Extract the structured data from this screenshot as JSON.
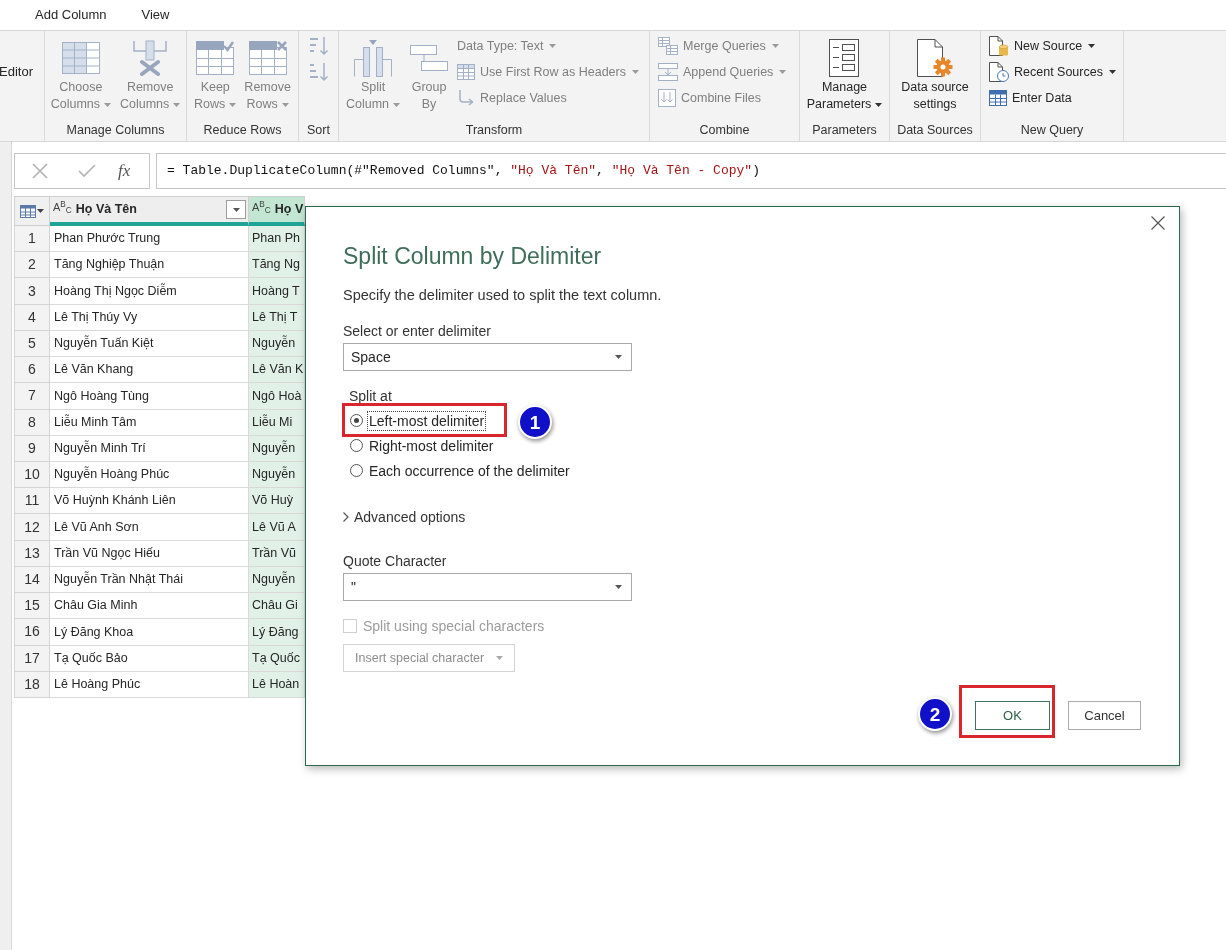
{
  "menu_tabs": [
    "Add Column",
    "View"
  ],
  "ribbon": {
    "stub_label": "Editor",
    "groups": [
      {
        "label": "Manage Columns",
        "buttons": [
          {
            "kind": "large",
            "lines": [
              "Choose",
              "Columns"
            ],
            "dropdown": true,
            "disabled": true
          },
          {
            "kind": "large",
            "lines": [
              "Remove",
              "Columns"
            ],
            "dropdown": true,
            "disabled": true
          }
        ]
      },
      {
        "label": "Reduce Rows",
        "buttons": [
          {
            "kind": "large",
            "lines": [
              "Keep",
              "Rows"
            ],
            "dropdown": true,
            "disabled": true
          },
          {
            "kind": "large",
            "lines": [
              "Remove",
              "Rows"
            ],
            "dropdown": true,
            "disabled": true
          }
        ]
      },
      {
        "label": "Sort",
        "buttons": [
          {
            "kind": "icon",
            "disabled": true
          },
          {
            "kind": "icon",
            "disabled": true
          }
        ]
      },
      {
        "label": "Transform",
        "buttons": [
          {
            "kind": "large",
            "lines": [
              "Split",
              "Column"
            ],
            "dropdown": true,
            "disabled": true
          },
          {
            "kind": "large",
            "lines": [
              "Group",
              "By"
            ],
            "dropdown": false,
            "disabled": true
          },
          {
            "kind": "small",
            "label": "Data Type: Text",
            "dropdown": true,
            "disabled": true
          },
          {
            "kind": "small",
            "label": "Use First Row as Headers",
            "dropdown": true,
            "disabled": true
          },
          {
            "kind": "small",
            "label": "Replace Values",
            "dropdown": false,
            "disabled": true
          }
        ]
      },
      {
        "label": "Combine",
        "buttons": [
          {
            "kind": "small",
            "label": "Merge Queries",
            "dropdown": true,
            "disabled": true
          },
          {
            "kind": "small",
            "label": "Append Queries",
            "dropdown": true,
            "disabled": true
          },
          {
            "kind": "small",
            "label": "Combine Files",
            "dropdown": false,
            "disabled": true
          }
        ]
      },
      {
        "label": "Parameters",
        "buttons": [
          {
            "kind": "large",
            "lines": [
              "Manage",
              "Parameters"
            ],
            "dropdown": true,
            "disabled": false
          }
        ]
      },
      {
        "label": "Data Sources",
        "buttons": [
          {
            "kind": "large",
            "lines": [
              "Data source",
              "settings"
            ],
            "dropdown": false,
            "disabled": false
          }
        ]
      },
      {
        "label": "New Query",
        "buttons": [
          {
            "kind": "small",
            "label": "New Source",
            "dropdown": true,
            "disabled": false
          },
          {
            "kind": "small",
            "label": "Recent Sources",
            "dropdown": true,
            "disabled": false
          },
          {
            "kind": "small",
            "label": "Enter Data",
            "dropdown": false,
            "disabled": false
          }
        ]
      }
    ]
  },
  "formula_bar": {
    "fx_label": "fx",
    "formula": [
      {
        "text": "= Table.DuplicateColumn(#\"Removed Columns\", ",
        "kind": "code"
      },
      {
        "text": "\"Họ Và Tên\"",
        "kind": "string"
      },
      {
        "text": ", ",
        "kind": "code"
      },
      {
        "text": "\"Họ Và Tên - Copy\"",
        "kind": "string"
      },
      {
        "text": ")",
        "kind": "code"
      }
    ]
  },
  "table": {
    "columns": [
      {
        "type": "A$^{B}$$_{C}$",
        "label": "Họ Và Tên",
        "selected": false,
        "filter": true
      },
      {
        "type": "A$^{B}$$_{C}$",
        "label": "Họ V",
        "selected": true
      }
    ],
    "rows": [
      {
        "number": "1",
        "cells": [
          "Phan Phước Trung",
          "Phan Ph"
        ]
      },
      {
        "number": "2",
        "cells": [
          "Tăng Nghiệp Thuận",
          "Tăng Ng"
        ]
      },
      {
        "number": "3",
        "cells": [
          "Hoàng Thị Ngọc Diễm",
          "Hoàng T"
        ]
      },
      {
        "number": "4",
        "cells": [
          "Lê Thị Thúy Vy",
          "Lê Thị T"
        ]
      },
      {
        "number": "5",
        "cells": [
          "Nguyễn Tuấn Kiệt",
          "Nguyễn"
        ]
      },
      {
        "number": "6",
        "cells": [
          "Lê Văn Khang",
          "Lê Văn K"
        ]
      },
      {
        "number": "7",
        "cells": [
          "Ngô Hoàng Tùng",
          "Ngô Hoà"
        ]
      },
      {
        "number": "8",
        "cells": [
          "Liễu Minh Tâm",
          "Liễu Mi"
        ]
      },
      {
        "number": "9",
        "cells": [
          "Nguyễn Minh Trí",
          "Nguyễn"
        ]
      },
      {
        "number": "10",
        "cells": [
          "Nguyễn Hoàng Phúc",
          "Nguyễn"
        ]
      },
      {
        "number": "11",
        "cells": [
          "Võ Huỳnh Khánh Liên",
          "Võ Huỳ"
        ]
      },
      {
        "number": "12",
        "cells": [
          "Lê Vũ Anh Sơn",
          "Lê Vũ A"
        ]
      },
      {
        "number": "13",
        "cells": [
          "Trần Vũ Ngọc Hiếu",
          "Trần Vũ"
        ]
      },
      {
        "number": "14",
        "cells": [
          "Nguyễn Trần Nhật Thái",
          "Nguyễn"
        ]
      },
      {
        "number": "15",
        "cells": [
          "Châu Gia Minh",
          "Châu Gi"
        ]
      },
      {
        "number": "16",
        "cells": [
          "Lý Đăng Khoa",
          "Lý Đăng"
        ]
      },
      {
        "number": "17",
        "cells": [
          "Tạ Quốc Bảo",
          "Tạ Quốc"
        ]
      },
      {
        "number": "18",
        "cells": [
          "Lê Hoàng Phúc",
          "Lê Hoàn"
        ]
      }
    ]
  },
  "dialog": {
    "title": "Split Column by Delimiter",
    "description": "Specify the delimiter used to split the text column.",
    "delimiter": {
      "label": "Select or enter delimiter",
      "value": "Space"
    },
    "split_at": {
      "label": "Split at",
      "options": [
        {
          "label": "Left-most delimiter",
          "selected": true,
          "focused": true,
          "annotation": "1"
        },
        {
          "label": "Right-most delimiter",
          "selected": false,
          "focused": false
        },
        {
          "label": "Each occurrence of the delimiter",
          "selected": false,
          "focused": false
        }
      ]
    },
    "advanced": {
      "label": "Advanced options",
      "expanded": false
    },
    "quote": {
      "label": "Quote Character",
      "value": "\""
    },
    "special": {
      "label": "Split using special characters",
      "checked": false,
      "disabled": true
    },
    "insert_button": {
      "label": "Insert special character",
      "disabled": true
    },
    "buttons": [
      {
        "label": "OK",
        "kind": "primary",
        "annotation": "2"
      },
      {
        "label": "Cancel",
        "kind": "secondary"
      }
    ]
  }
}
